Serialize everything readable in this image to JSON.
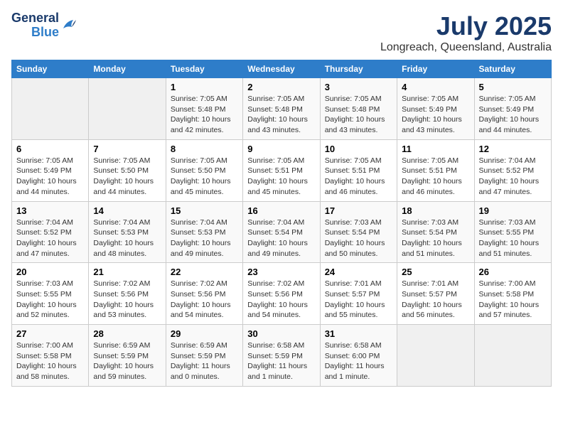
{
  "logo": {
    "line1": "General",
    "line2": "Blue"
  },
  "title": "July 2025",
  "location": "Longreach, Queensland, Australia",
  "days_header": [
    "Sunday",
    "Monday",
    "Tuesday",
    "Wednesday",
    "Thursday",
    "Friday",
    "Saturday"
  ],
  "weeks": [
    [
      {
        "day": "",
        "info": ""
      },
      {
        "day": "",
        "info": ""
      },
      {
        "day": "1",
        "info": "Sunrise: 7:05 AM\nSunset: 5:48 PM\nDaylight: 10 hours and 42 minutes."
      },
      {
        "day": "2",
        "info": "Sunrise: 7:05 AM\nSunset: 5:48 PM\nDaylight: 10 hours and 43 minutes."
      },
      {
        "day": "3",
        "info": "Sunrise: 7:05 AM\nSunset: 5:48 PM\nDaylight: 10 hours and 43 minutes."
      },
      {
        "day": "4",
        "info": "Sunrise: 7:05 AM\nSunset: 5:49 PM\nDaylight: 10 hours and 43 minutes."
      },
      {
        "day": "5",
        "info": "Sunrise: 7:05 AM\nSunset: 5:49 PM\nDaylight: 10 hours and 44 minutes."
      }
    ],
    [
      {
        "day": "6",
        "info": "Sunrise: 7:05 AM\nSunset: 5:49 PM\nDaylight: 10 hours and 44 minutes."
      },
      {
        "day": "7",
        "info": "Sunrise: 7:05 AM\nSunset: 5:50 PM\nDaylight: 10 hours and 44 minutes."
      },
      {
        "day": "8",
        "info": "Sunrise: 7:05 AM\nSunset: 5:50 PM\nDaylight: 10 hours and 45 minutes."
      },
      {
        "day": "9",
        "info": "Sunrise: 7:05 AM\nSunset: 5:51 PM\nDaylight: 10 hours and 45 minutes."
      },
      {
        "day": "10",
        "info": "Sunrise: 7:05 AM\nSunset: 5:51 PM\nDaylight: 10 hours and 46 minutes."
      },
      {
        "day": "11",
        "info": "Sunrise: 7:05 AM\nSunset: 5:51 PM\nDaylight: 10 hours and 46 minutes."
      },
      {
        "day": "12",
        "info": "Sunrise: 7:04 AM\nSunset: 5:52 PM\nDaylight: 10 hours and 47 minutes."
      }
    ],
    [
      {
        "day": "13",
        "info": "Sunrise: 7:04 AM\nSunset: 5:52 PM\nDaylight: 10 hours and 47 minutes."
      },
      {
        "day": "14",
        "info": "Sunrise: 7:04 AM\nSunset: 5:53 PM\nDaylight: 10 hours and 48 minutes."
      },
      {
        "day": "15",
        "info": "Sunrise: 7:04 AM\nSunset: 5:53 PM\nDaylight: 10 hours and 49 minutes."
      },
      {
        "day": "16",
        "info": "Sunrise: 7:04 AM\nSunset: 5:54 PM\nDaylight: 10 hours and 49 minutes."
      },
      {
        "day": "17",
        "info": "Sunrise: 7:03 AM\nSunset: 5:54 PM\nDaylight: 10 hours and 50 minutes."
      },
      {
        "day": "18",
        "info": "Sunrise: 7:03 AM\nSunset: 5:54 PM\nDaylight: 10 hours and 51 minutes."
      },
      {
        "day": "19",
        "info": "Sunrise: 7:03 AM\nSunset: 5:55 PM\nDaylight: 10 hours and 51 minutes."
      }
    ],
    [
      {
        "day": "20",
        "info": "Sunrise: 7:03 AM\nSunset: 5:55 PM\nDaylight: 10 hours and 52 minutes."
      },
      {
        "day": "21",
        "info": "Sunrise: 7:02 AM\nSunset: 5:56 PM\nDaylight: 10 hours and 53 minutes."
      },
      {
        "day": "22",
        "info": "Sunrise: 7:02 AM\nSunset: 5:56 PM\nDaylight: 10 hours and 54 minutes."
      },
      {
        "day": "23",
        "info": "Sunrise: 7:02 AM\nSunset: 5:56 PM\nDaylight: 10 hours and 54 minutes."
      },
      {
        "day": "24",
        "info": "Sunrise: 7:01 AM\nSunset: 5:57 PM\nDaylight: 10 hours and 55 minutes."
      },
      {
        "day": "25",
        "info": "Sunrise: 7:01 AM\nSunset: 5:57 PM\nDaylight: 10 hours and 56 minutes."
      },
      {
        "day": "26",
        "info": "Sunrise: 7:00 AM\nSunset: 5:58 PM\nDaylight: 10 hours and 57 minutes."
      }
    ],
    [
      {
        "day": "27",
        "info": "Sunrise: 7:00 AM\nSunset: 5:58 PM\nDaylight: 10 hours and 58 minutes."
      },
      {
        "day": "28",
        "info": "Sunrise: 6:59 AM\nSunset: 5:59 PM\nDaylight: 10 hours and 59 minutes."
      },
      {
        "day": "29",
        "info": "Sunrise: 6:59 AM\nSunset: 5:59 PM\nDaylight: 11 hours and 0 minutes."
      },
      {
        "day": "30",
        "info": "Sunrise: 6:58 AM\nSunset: 5:59 PM\nDaylight: 11 hours and 1 minute."
      },
      {
        "day": "31",
        "info": "Sunrise: 6:58 AM\nSunset: 6:00 PM\nDaylight: 11 hours and 1 minute."
      },
      {
        "day": "",
        "info": ""
      },
      {
        "day": "",
        "info": ""
      }
    ]
  ]
}
